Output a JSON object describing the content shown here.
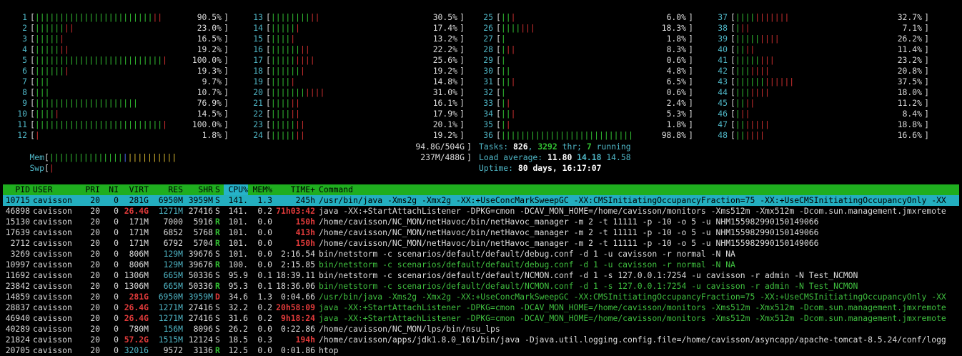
{
  "cpus": [
    {
      "n": "1",
      "pct": "90.5%",
      "green": 24,
      "red": 2
    },
    {
      "n": "2",
      "pct": "23.0%",
      "green": 6,
      "red": 2
    },
    {
      "n": "3",
      "pct": "16.5%",
      "green": 5,
      "red": 1
    },
    {
      "n": "4",
      "pct": "19.2%",
      "green": 5,
      "red": 2
    },
    {
      "n": "5",
      "pct": "100.0%",
      "green": 26,
      "red": 1
    },
    {
      "n": "6",
      "pct": "19.3%",
      "green": 6,
      "red": 1
    },
    {
      "n": "7",
      "pct": "9.7%",
      "green": 3,
      "red": 0
    },
    {
      "n": "8",
      "pct": "10.7%",
      "green": 3,
      "red": 0
    },
    {
      "n": "9",
      "pct": "76.9%",
      "green": 21,
      "red": 0
    },
    {
      "n": "10",
      "pct": "14.5%",
      "green": 4,
      "red": 1
    },
    {
      "n": "11",
      "pct": "100.0%",
      "green": 26,
      "red": 1
    },
    {
      "n": "12",
      "pct": "1.8%",
      "green": 0,
      "red": 1
    },
    {
      "n": "13",
      "pct": "30.5%",
      "green": 8,
      "red": 2
    },
    {
      "n": "14",
      "pct": "17.4%",
      "green": 5,
      "red": 1
    },
    {
      "n": "15",
      "pct": "13.2%",
      "green": 4,
      "red": 1
    },
    {
      "n": "16",
      "pct": "22.2%",
      "green": 6,
      "red": 2
    },
    {
      "n": "17",
      "pct": "25.6%",
      "green": 5,
      "red": 4
    },
    {
      "n": "18",
      "pct": "19.2%",
      "green": 6,
      "red": 1
    },
    {
      "n": "19",
      "pct": "14.8%",
      "green": 4,
      "red": 1
    },
    {
      "n": "20",
      "pct": "31.0%",
      "green": 7,
      "red": 4
    },
    {
      "n": "21",
      "pct": "16.1%",
      "green": 4,
      "red": 2
    },
    {
      "n": "22",
      "pct": "17.9%",
      "green": 4,
      "red": 2
    },
    {
      "n": "23",
      "pct": "20.1%",
      "green": 5,
      "red": 2
    },
    {
      "n": "24",
      "pct": "19.2%",
      "green": 5,
      "red": 2
    },
    {
      "n": "25",
      "pct": "6.0%",
      "green": 2,
      "red": 1
    },
    {
      "n": "26",
      "pct": "18.3%",
      "green": 4,
      "red": 3
    },
    {
      "n": "27",
      "pct": "1.8%",
      "green": 1,
      "red": 0
    },
    {
      "n": "28",
      "pct": "8.3%",
      "green": 1,
      "red": 2
    },
    {
      "n": "29",
      "pct": "0.6%",
      "green": 1,
      "red": 0
    },
    {
      "n": "30",
      "pct": "4.8%",
      "green": 2,
      "red": 0
    },
    {
      "n": "31",
      "pct": "6.5%",
      "green": 2,
      "red": 1
    },
    {
      "n": "32",
      "pct": "0.6%",
      "green": 1,
      "red": 0
    },
    {
      "n": "33",
      "pct": "2.4%",
      "green": 1,
      "red": 1
    },
    {
      "n": "34",
      "pct": "5.3%",
      "green": 2,
      "red": 1
    },
    {
      "n": "35",
      "pct": "1.8%",
      "green": 1,
      "red": 1
    },
    {
      "n": "36",
      "pct": "98.8%",
      "green": 27,
      "red": 0
    },
    {
      "n": "37",
      "pct": "32.7%",
      "green": 4,
      "red": 7
    },
    {
      "n": "38",
      "pct": "7.1%",
      "green": 1,
      "red": 2
    },
    {
      "n": "39",
      "pct": "26.2%",
      "green": 5,
      "red": 4
    },
    {
      "n": "40",
      "pct": "11.4%",
      "green": 2,
      "red": 2
    },
    {
      "n": "41",
      "pct": "23.2%",
      "green": 5,
      "red": 3
    },
    {
      "n": "42",
      "pct": "20.8%",
      "green": 3,
      "red": 4
    },
    {
      "n": "43",
      "pct": "37.5%",
      "green": 6,
      "red": 6
    },
    {
      "n": "44",
      "pct": "18.0%",
      "green": 3,
      "red": 4
    },
    {
      "n": "45",
      "pct": "11.2%",
      "green": 2,
      "red": 2
    },
    {
      "n": "46",
      "pct": "8.4%",
      "green": 1,
      "red": 2
    },
    {
      "n": "47",
      "pct": "18.8%",
      "green": 2,
      "red": 5
    },
    {
      "n": "48",
      "pct": "16.6%",
      "green": 2,
      "red": 4
    }
  ],
  "mem": {
    "label": "Mem",
    "value": "94.8G/504G",
    "green": 15,
    "blue": 1,
    "yellow": 10
  },
  "swp": {
    "label": "Swp",
    "value": "237M/488G",
    "red": 1
  },
  "tasks": {
    "label": "Tasks: ",
    "count": "826",
    "sep1": ", ",
    "thr": "3292",
    "thr_label": " thr; ",
    "running": "7",
    "running_label": " running"
  },
  "load": {
    "label": "Load average: ",
    "l1": "11.80",
    "l5": "14.18",
    "l15": "14.58"
  },
  "uptime": {
    "label": "Uptime: ",
    "value": "80 days, 16:17:07"
  },
  "columns": {
    "pid": "PID",
    "user": "USER",
    "pri": "PRI",
    "ni": "NI",
    "virt": "VIRT",
    "res": "RES",
    "shr": "SHR",
    "s": "S",
    "cpu": "CPU%",
    "mem": "MEM%",
    "time": "TIME+",
    "cmd": "Command"
  },
  "processes": [
    {
      "pid": "10715",
      "user": "cavisson",
      "pri": "20",
      "ni": "0",
      "virt": "281G",
      "res": "6950M",
      "shr": "3959M",
      "s": "S",
      "cpu": "141.",
      "mem": "1.3",
      "time": "245h",
      "cmd": "/usr/bin/java -Xms2g -Xmx2g -XX:+UseConcMarkSweepGC -XX:CMSInitiatingOccupancyFraction=75 -XX:+UseCMSInitiatingOccupancyOnly -XX",
      "selected": true
    },
    {
      "pid": "46898",
      "user": "cavisson",
      "pri": "20",
      "ni": "0",
      "virt": "26.4G",
      "res": "1271M",
      "shr": "27416",
      "s": "S",
      "cpu": "141.",
      "mem": "0.2",
      "time": "71h03:42",
      "cmd": "java -XX:+StartAttachListener -DPKG=cmon -DCAV_MON_HOME=/home/cavisson/monitors -Xms512m -Xmx512m -Dcom.sun.management.jmxremote"
    },
    {
      "pid": "15130",
      "user": "cavisson",
      "pri": "20",
      "ni": "0",
      "virt": "171M",
      "res": "7000",
      "shr": "5916",
      "s": "R",
      "cpu": "101.",
      "mem": "0.0",
      "time": "150h",
      "cmd": "/home/cavisson/NC_MON/netHavoc/bin/netHavoc_manager -m 2 -t 11111 -p -10 -o 5 -u NHM155982990150149066"
    },
    {
      "pid": "17639",
      "user": "cavisson",
      "pri": "20",
      "ni": "0",
      "virt": "171M",
      "res": "6852",
      "shr": "5768",
      "s": "R",
      "cpu": "101.",
      "mem": "0.0",
      "time": "413h",
      "cmd": "/home/cavisson/NC_MON/netHavoc/bin/netHavoc_manager -m 2 -t 11111 -p -10 -o 5 -u NHM155982990150149066"
    },
    {
      "pid": "2712",
      "user": "cavisson",
      "pri": "20",
      "ni": "0",
      "virt": "171M",
      "res": "6792",
      "shr": "5704",
      "s": "R",
      "cpu": "101.",
      "mem": "0.0",
      "time": "150h",
      "cmd": "/home/cavisson/NC_MON/netHavoc/bin/netHavoc_manager -m 2 -t 11111 -p -10 -o 5 -u NHM155982990150149066"
    },
    {
      "pid": "3269",
      "user": "cavisson",
      "pri": "20",
      "ni": "0",
      "virt": "806M",
      "res": "129M",
      "shr": "39676",
      "s": "S",
      "cpu": "101.",
      "mem": "0.0",
      "time": "2:16.54",
      "cmd": "bin/netstorm -c scenarios/default/default/debug.conf -d 1 -u cavisson -r normal -N NA"
    },
    {
      "pid": "10997",
      "user": "cavisson",
      "pri": "20",
      "ni": "0",
      "virt": "806M",
      "res": "129M",
      "shr": "39676",
      "s": "R",
      "cpu": "100.",
      "mem": "0.0",
      "time": "2:15.85",
      "cmd": "bin/netstorm -c scenarios/default/default/debug.conf -d 1 -u cavisson -r normal -N NA",
      "green": true
    },
    {
      "pid": "11692",
      "user": "cavisson",
      "pri": "20",
      "ni": "0",
      "virt": "1306M",
      "res": "665M",
      "shr": "50336",
      "s": "S",
      "cpu": "95.9",
      "mem": "0.1",
      "time": "18:39.11",
      "cmd": "bin/netstorm -c scenarios/default/default/NCMON.conf -d 1 -s 127.0.0.1:7254 -u cavisson -r admin -N Test_NCMON"
    },
    {
      "pid": "23842",
      "user": "cavisson",
      "pri": "20",
      "ni": "0",
      "virt": "1306M",
      "res": "665M",
      "shr": "50336",
      "s": "R",
      "cpu": "95.3",
      "mem": "0.1",
      "time": "18:36.06",
      "cmd": "bin/netstorm -c scenarios/default/default/NCMON.conf -d 1 -s 127.0.0.1:7254 -u cavisson -r admin -N Test_NCMON",
      "green": true
    },
    {
      "pid": "14859",
      "user": "cavisson",
      "pri": "20",
      "ni": "0",
      "virt": "281G",
      "res": "6950M",
      "shr": "3959M",
      "s": "D",
      "cpu": "34.6",
      "mem": "1.3",
      "time": "0:04.66",
      "cmd": "/usr/bin/java -Xms2g -Xmx2g -XX:+UseConcMarkSweepGC -XX:CMSInitiatingOccupancyFraction=75 -XX:+UseCMSInitiatingOccupancyOnly -XX",
      "green": true
    },
    {
      "pid": "28837",
      "user": "cavisson",
      "pri": "20",
      "ni": "0",
      "virt": "26.4G",
      "res": "1271M",
      "shr": "27416",
      "s": "S",
      "cpu": "32.2",
      "mem": "0.2",
      "time": "20h58:09",
      "cmd": "java -XX:+StartAttachListener -DPKG=cmon -DCAV_MON_HOME=/home/cavisson/monitors -Xms512m -Xmx512m -Dcom.sun.management.jmxremote",
      "green": true
    },
    {
      "pid": "46940",
      "user": "cavisson",
      "pri": "20",
      "ni": "0",
      "virt": "26.4G",
      "res": "1271M",
      "shr": "27416",
      "s": "S",
      "cpu": "31.6",
      "mem": "0.2",
      "time": "9h18:24",
      "cmd": "java -XX:+StartAttachListener -DPKG=cmon -DCAV_MON_HOME=/home/cavisson/monitors -Xms512m -Xmx512m -Dcom.sun.management.jmxremote",
      "green": true
    },
    {
      "pid": "40289",
      "user": "cavisson",
      "pri": "20",
      "ni": "0",
      "virt": "780M",
      "res": "156M",
      "shr": "8096",
      "s": "S",
      "cpu": "26.2",
      "mem": "0.0",
      "time": "0:22.86",
      "cmd": "/home/cavisson/NC_MON/lps/bin/nsu_lps"
    },
    {
      "pid": "21824",
      "user": "cavisson",
      "pri": "20",
      "ni": "0",
      "virt": "57.2G",
      "res": "1515M",
      "shr": "12124",
      "s": "S",
      "cpu": "18.5",
      "mem": "0.3",
      "time": "194h",
      "cmd": "/home/cavisson/apps/jdk1.8.0_161/bin/java -Djava.util.logging.config.file=/home/cavisson/asyncapp/apache-tomcat-8.5.24/conf/logg"
    },
    {
      "pid": "20705",
      "user": "cavisson",
      "pri": "20",
      "ni": "0",
      "virt": "32016",
      "res": "9572",
      "shr": "3136",
      "s": "R",
      "cpu": "12.5",
      "mem": "0.0",
      "time": "0:01.86",
      "cmd": "htop"
    }
  ]
}
